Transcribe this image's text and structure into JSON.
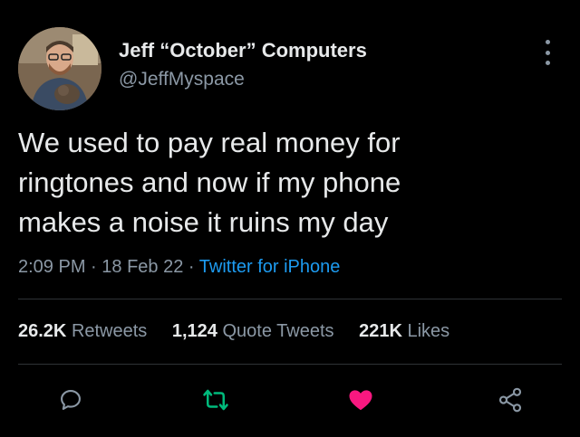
{
  "tweet": {
    "display_name": "Jeff “October” Computers",
    "handle": "@JeffMyspace",
    "lines": [
      "We used to pay real money for",
      "ringtones and now if my phone",
      "makes a noise it ruins my day"
    ],
    "time": "2:09 PM",
    "separator": " · ",
    "date": "18 Feb 22",
    "source": "Twitter for iPhone"
  },
  "stats": {
    "retweets_count": "26.2K",
    "retweets_label": "Retweets",
    "quotes_count": "1,124",
    "quotes_label": "Quote Tweets",
    "likes_count": "221K",
    "likes_label": "Likes"
  },
  "actions": {
    "reply_icon": "reply-icon",
    "retweet_icon": "retweet-icon",
    "like_icon": "heart-icon",
    "share_icon": "share-icon"
  },
  "colors": {
    "background": "#000000",
    "text": "#e7e9ea",
    "muted": "#8b98a5",
    "link": "#1d9bf0",
    "retweet": "#00ba7c",
    "like": "#f91880"
  }
}
